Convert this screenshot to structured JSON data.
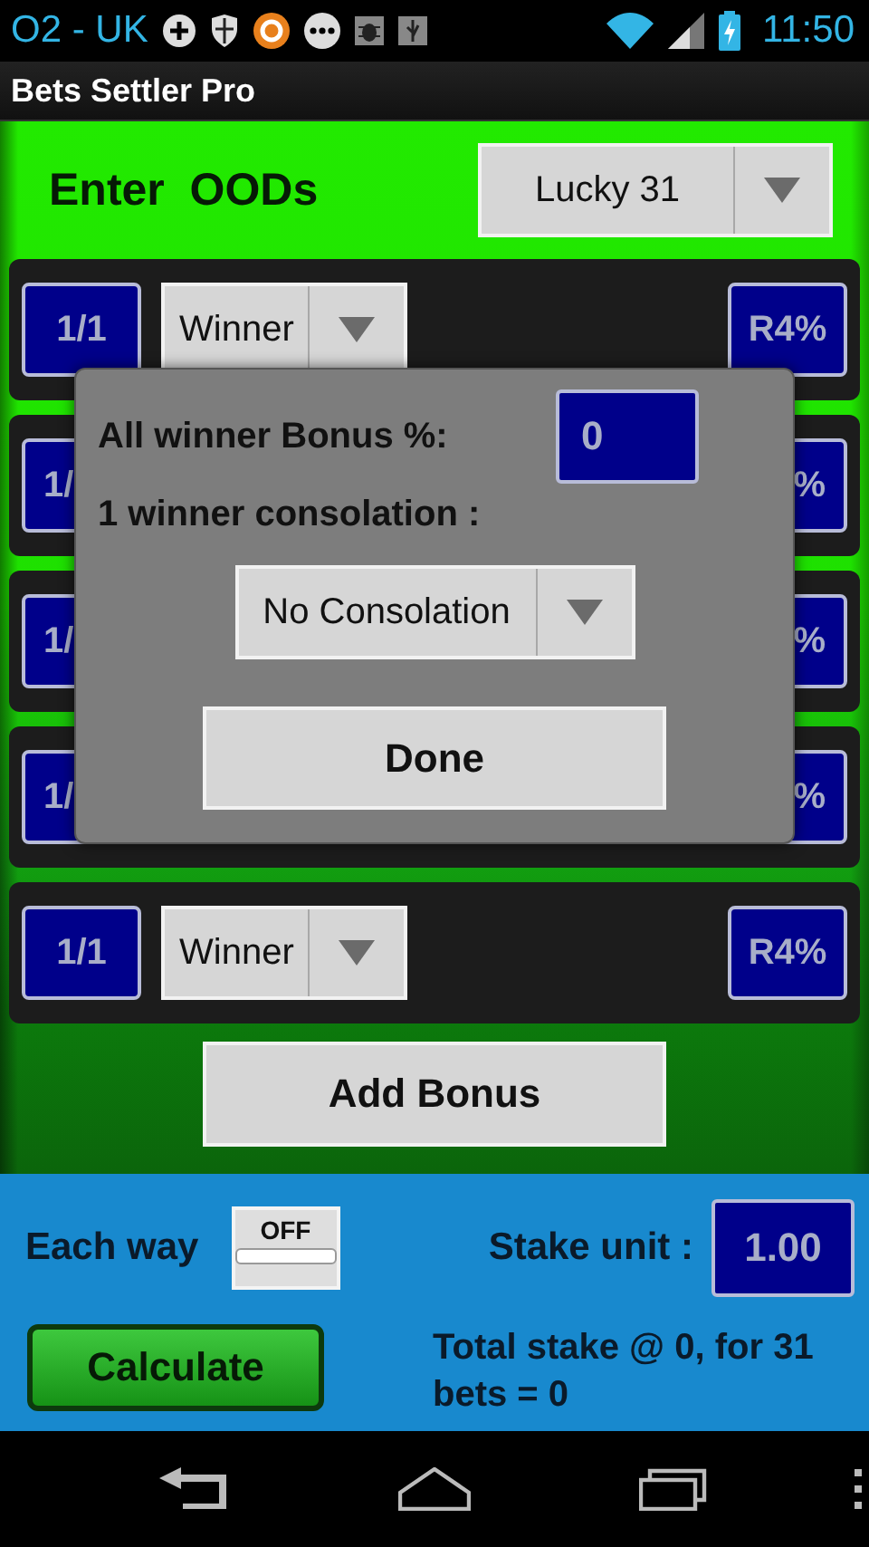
{
  "status_bar": {
    "carrier": "O2 - UK",
    "time": "11:50"
  },
  "action_bar": {
    "title": "Bets Settler Pro"
  },
  "header": {
    "label": "Enter  OODs",
    "bet_type": "Lucky 31"
  },
  "selections": [
    {
      "odds": "1/1",
      "result": "Winner",
      "rule": "R4%"
    },
    {
      "odds": "1/",
      "rule": "%"
    },
    {
      "odds": "1/",
      "rule": "%"
    },
    {
      "odds": "1/",
      "rule": "%"
    },
    {
      "odds": "1/1",
      "result": "Winner",
      "rule": "R4%"
    }
  ],
  "add_bonus_button": "Add Bonus",
  "dialog": {
    "bonus_label": "All winner Bonus %:",
    "bonus_value": "0",
    "consolation_label": "1 winner consolation :",
    "consolation": "No Consolation",
    "done_button": "Done"
  },
  "each_way": {
    "label": "Each way",
    "on": false,
    "state_text": "OFF"
  },
  "stake_unit": {
    "label": "Stake unit :",
    "value": "1.00"
  },
  "calculate_button": "Calculate",
  "total": "Total stake @ 0, for 31 bets = 0"
}
